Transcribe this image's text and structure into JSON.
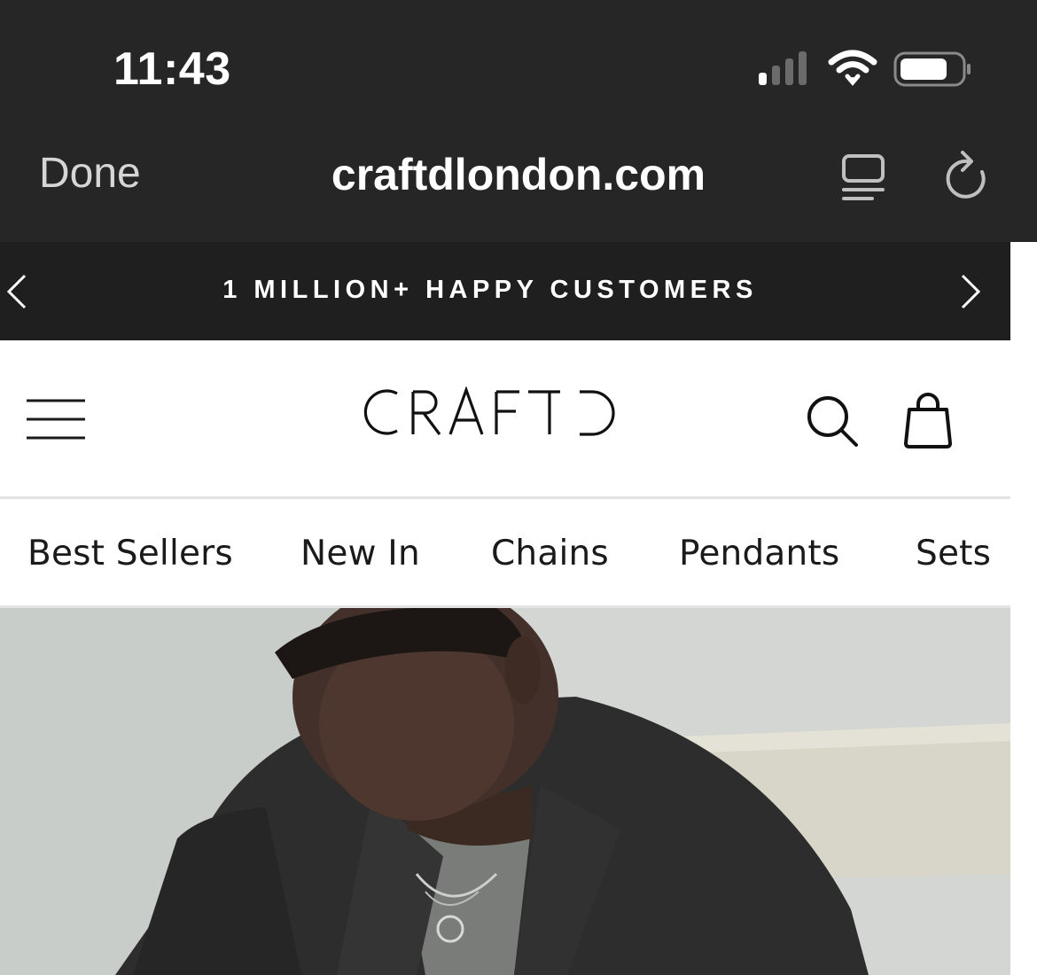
{
  "status_bar": {
    "time": "11:43",
    "icons": [
      "cellular-signal-icon",
      "wifi-icon",
      "battery-icon"
    ]
  },
  "browser": {
    "done_label": "Done",
    "url": "craftdlondon.com",
    "icons": [
      "reader-view-icon",
      "reload-icon"
    ]
  },
  "announcement": {
    "text": "1 MILLION+ HAPPY CUSTOMERS"
  },
  "header": {
    "logo_text": "CRAFTD",
    "icons": [
      "hamburger-menu-icon",
      "search-icon",
      "shopping-bag-icon"
    ]
  },
  "categories": [
    "Best Sellers",
    "New In",
    "Chains",
    "Pendants",
    "Sets"
  ],
  "colors": {
    "browser_chrome": "#262626",
    "announcement_bar": "#1f1f1f",
    "text_dark": "#1a1a1a"
  }
}
